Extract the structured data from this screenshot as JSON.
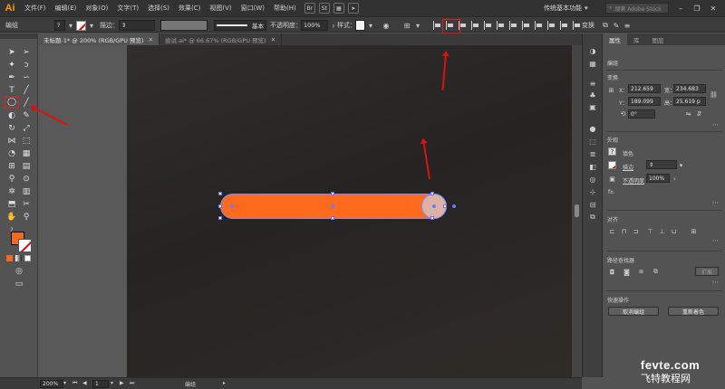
{
  "menubar": {
    "logo": "Ai",
    "items": [
      "文件(F)",
      "编辑(E)",
      "对象(O)",
      "文字(T)",
      "选择(S)",
      "效果(C)",
      "视图(V)",
      "窗口(W)",
      "帮助(H)"
    ],
    "mini_buttons": [
      "Br",
      "St"
    ],
    "workspace": "传统基本功能",
    "search_placeholder": "搜索 Adobe Stock"
  },
  "controlbar": {
    "selection_label": "编组",
    "stroke_label": "描边：",
    "stroke_style": "基本",
    "opacity_label": "不透明度：",
    "opacity_value": "100%",
    "style_label": "样式：",
    "transform_label": "变换"
  },
  "tabs": [
    {
      "label": "未标题-1* @ 200% (RGB/GPU 预览)",
      "active": true
    },
    {
      "label": "尝试.ai* @ 66.67% (RGB/GPU 预览)",
      "active": false
    }
  ],
  "tools": [
    "selection-tool",
    "direct-selection-tool",
    "magic-wand-tool",
    "lasso-tool",
    "pen-tool",
    "curvature-tool",
    "type-tool",
    "line-segment-tool",
    "ellipse-tool",
    "paintbrush-tool",
    "shaper-tool",
    "pencil-tool",
    "rotate-tool",
    "scale-tool",
    "width-tool",
    "free-transform-tool",
    "shape-builder-tool",
    "perspective-grid-tool",
    "mesh-tool",
    "gradient-tool",
    "eyedropper-tool",
    "blend-tool",
    "symbol-sprayer-tool",
    "column-graph-tool",
    "artboard-tool",
    "slice-tool",
    "hand-tool",
    "zoom-tool"
  ],
  "colors": {
    "shape_fill": "#ff6a1c",
    "circle_fill": "#ddb2a4",
    "selection": "#7a8cff",
    "annotation": "#e01010"
  },
  "panel": {
    "tabs": [
      "属性",
      "库",
      "图层"
    ],
    "section_group": "编组",
    "transform_title": "变换",
    "x_label": "X：",
    "x_value": "212.659",
    "y_label": "Y：",
    "y_value": "189.099",
    "w_label": "宽：",
    "w_value": "234.683",
    "h_label": "高：",
    "h_value": "25.619 p",
    "angle_value": "0°",
    "appearance_title": "外观",
    "fill_label": "填色",
    "stroke_label": "描边",
    "opacity_label": "不透明度",
    "opacity_value": "100%",
    "fx_label": "fx.",
    "align_title": "对齐",
    "pathfinder_title": "路径查找器",
    "expand_label": "扩展",
    "quick_actions_title": "快速操作",
    "ungroup_button": "取消编组",
    "recolor_button": "重新着色"
  },
  "statusbar": {
    "zoom": "200%",
    "artboard_number": "1",
    "tool_name": "编组"
  },
  "watermark": {
    "line1": "fevte.com",
    "line2": "飞特教程网"
  }
}
